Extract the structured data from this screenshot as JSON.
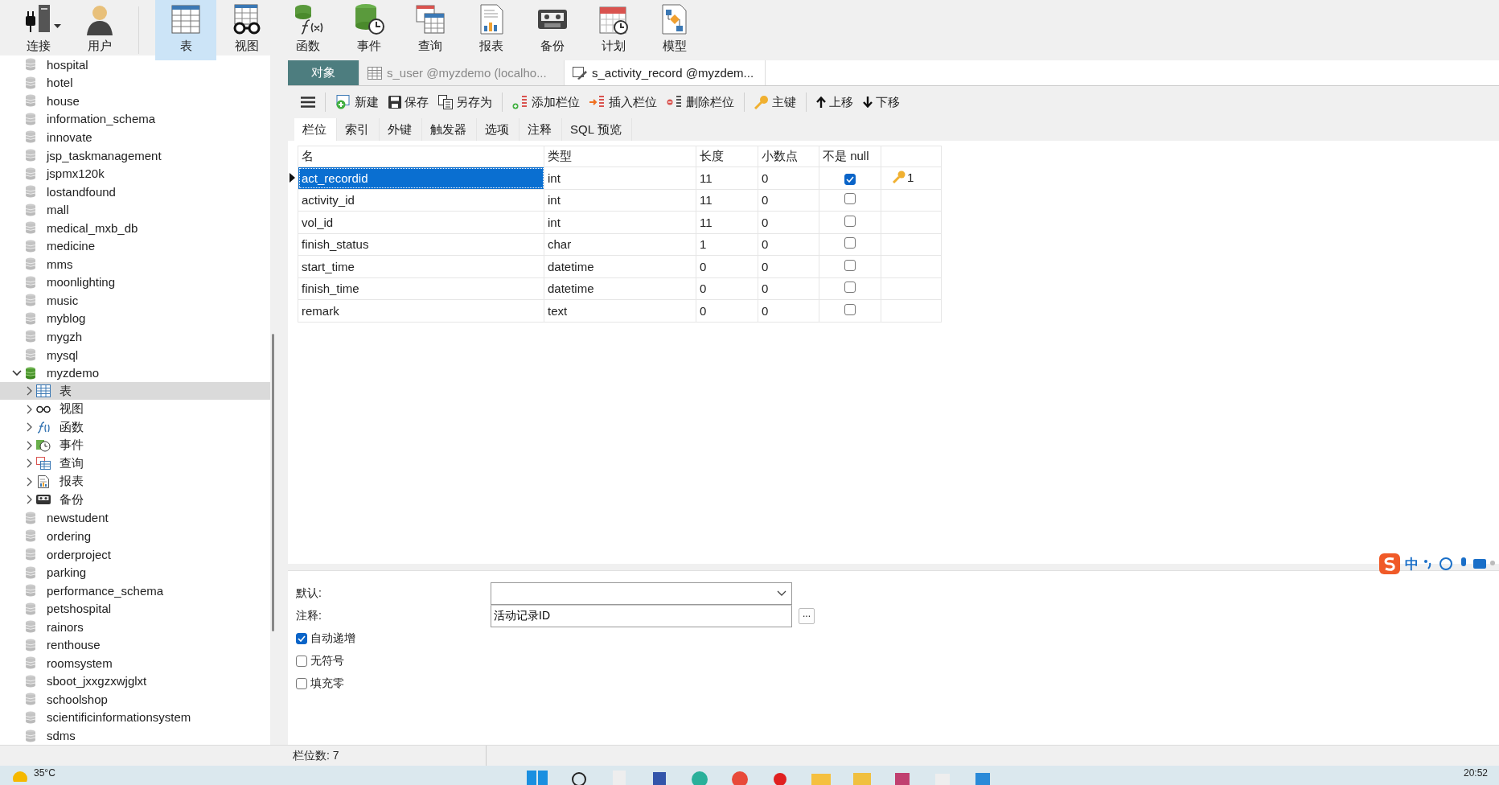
{
  "main_toolbar": [
    {
      "label": "连接",
      "kind": "connection",
      "selected": false,
      "has_menu": true
    },
    {
      "label": "用户",
      "kind": "user",
      "selected": false,
      "has_menu": false
    },
    {
      "label": "表",
      "kind": "table",
      "selected": true,
      "has_menu": false
    },
    {
      "label": "视图",
      "kind": "view",
      "selected": false,
      "has_menu": false
    },
    {
      "label": "函数",
      "kind": "function",
      "selected": false,
      "has_menu": false
    },
    {
      "label": "事件",
      "kind": "event",
      "selected": false,
      "has_menu": false
    },
    {
      "label": "查询",
      "kind": "query",
      "selected": false,
      "has_menu": false
    },
    {
      "label": "报表",
      "kind": "report",
      "selected": false,
      "has_menu": false
    },
    {
      "label": "备份",
      "kind": "backup",
      "selected": false,
      "has_menu": false
    },
    {
      "label": "计划",
      "kind": "schedule",
      "selected": false,
      "has_menu": false
    },
    {
      "label": "模型",
      "kind": "model",
      "selected": false,
      "has_menu": false
    }
  ],
  "sidebar": {
    "items": [
      {
        "label": "hospital",
        "kind": "database",
        "expanded": false,
        "selected": false
      },
      {
        "label": "hotel",
        "kind": "database",
        "expanded": false,
        "selected": false
      },
      {
        "label": "house",
        "kind": "database",
        "expanded": false,
        "selected": false
      },
      {
        "label": "information_schema",
        "kind": "database",
        "expanded": false,
        "selected": false
      },
      {
        "label": "innovate",
        "kind": "database",
        "expanded": false,
        "selected": false
      },
      {
        "label": "jsp_taskmanagement",
        "kind": "database",
        "expanded": false,
        "selected": false
      },
      {
        "label": "jspmx120k",
        "kind": "database",
        "expanded": false,
        "selected": false
      },
      {
        "label": "lostandfound",
        "kind": "database",
        "expanded": false,
        "selected": false
      },
      {
        "label": "mall",
        "kind": "database",
        "expanded": false,
        "selected": false
      },
      {
        "label": "medical_mxb_db",
        "kind": "database",
        "expanded": false,
        "selected": false
      },
      {
        "label": "medicine",
        "kind": "database",
        "expanded": false,
        "selected": false
      },
      {
        "label": "mms",
        "kind": "database",
        "expanded": false,
        "selected": false
      },
      {
        "label": "moonlighting",
        "kind": "database",
        "expanded": false,
        "selected": false
      },
      {
        "label": "music",
        "kind": "database",
        "expanded": false,
        "selected": false
      },
      {
        "label": "myblog",
        "kind": "database",
        "expanded": false,
        "selected": false
      },
      {
        "label": "mygzh",
        "kind": "database",
        "expanded": false,
        "selected": false
      },
      {
        "label": "mysql",
        "kind": "database",
        "expanded": false,
        "selected": false
      },
      {
        "label": "myzdemo",
        "kind": "database",
        "expanded": true,
        "selected": false,
        "children": [
          {
            "label": "表",
            "kind": "table",
            "expanded": false,
            "selected": true
          },
          {
            "label": "视图",
            "kind": "view",
            "expanded": false,
            "selected": false
          },
          {
            "label": "函数",
            "kind": "function",
            "expanded": false,
            "selected": false
          },
          {
            "label": "事件",
            "kind": "event",
            "expanded": false,
            "selected": false
          },
          {
            "label": "查询",
            "kind": "query",
            "expanded": false,
            "selected": false
          },
          {
            "label": "报表",
            "kind": "report",
            "expanded": false,
            "selected": false
          },
          {
            "label": "备份",
            "kind": "backup",
            "expanded": false,
            "selected": false
          }
        ]
      },
      {
        "label": "newstudent",
        "kind": "database",
        "expanded": false,
        "selected": false
      },
      {
        "label": "ordering",
        "kind": "database",
        "expanded": false,
        "selected": false
      },
      {
        "label": "orderproject",
        "kind": "database",
        "expanded": false,
        "selected": false
      },
      {
        "label": "parking",
        "kind": "database",
        "expanded": false,
        "selected": false
      },
      {
        "label": "performance_schema",
        "kind": "database",
        "expanded": false,
        "selected": false
      },
      {
        "label": "petshospital",
        "kind": "database",
        "expanded": false,
        "selected": false
      },
      {
        "label": "rainors",
        "kind": "database",
        "expanded": false,
        "selected": false
      },
      {
        "label": "renthouse",
        "kind": "database",
        "expanded": false,
        "selected": false
      },
      {
        "label": "roomsystem",
        "kind": "database",
        "expanded": false,
        "selected": false
      },
      {
        "label": "sboot_jxxgzxwjglxt",
        "kind": "database",
        "expanded": false,
        "selected": false
      },
      {
        "label": "schoolshop",
        "kind": "database",
        "expanded": false,
        "selected": false
      },
      {
        "label": "scientificinformationsystem",
        "kind": "database",
        "expanded": false,
        "selected": false
      },
      {
        "label": "sdms",
        "kind": "database",
        "expanded": false,
        "selected": false
      }
    ]
  },
  "tabs": [
    {
      "label": "对象",
      "kind": "objects",
      "selected": false
    },
    {
      "label": "s_user @myzdemo (localho...",
      "kind": "table",
      "selected": false
    },
    {
      "label": "s_activity_record @myzdem...",
      "kind": "design",
      "selected": true
    }
  ],
  "editor_toolbar": [
    {
      "kind": "menu"
    },
    {
      "label": "新建",
      "kind": "new"
    },
    {
      "label": "保存",
      "kind": "save"
    },
    {
      "label": "另存为",
      "kind": "save_as"
    },
    {
      "label": "添加栏位",
      "kind": "add_field"
    },
    {
      "label": "插入栏位",
      "kind": "insert_field"
    },
    {
      "label": "删除栏位",
      "kind": "delete_field"
    },
    {
      "label": "主键",
      "kind": "primary_key"
    },
    {
      "label": "上移",
      "kind": "move_up"
    },
    {
      "label": "下移",
      "kind": "move_down"
    }
  ],
  "subtabs": [
    {
      "label": "栏位",
      "selected": true
    },
    {
      "label": "索引",
      "selected": false
    },
    {
      "label": "外键",
      "selected": false
    },
    {
      "label": "触发器",
      "selected": false
    },
    {
      "label": "选项",
      "selected": false
    },
    {
      "label": "注释",
      "selected": false
    },
    {
      "label": "SQL 预览",
      "selected": false
    }
  ],
  "table": {
    "columns": [
      "名",
      "类型",
      "长度",
      "小数点",
      "不是 null"
    ],
    "rows": [
      {
        "name": "act_recordid",
        "type": "int",
        "length": "11",
        "decimals": "0",
        "not_null": true,
        "key": "1",
        "selected": true
      },
      {
        "name": "activity_id",
        "type": "int",
        "length": "11",
        "decimals": "0",
        "not_null": false,
        "selected": false
      },
      {
        "name": "vol_id",
        "type": "int",
        "length": "11",
        "decimals": "0",
        "not_null": false,
        "selected": false
      },
      {
        "name": "finish_status",
        "type": "char",
        "length": "1",
        "decimals": "0",
        "not_null": false,
        "selected": false
      },
      {
        "name": "start_time",
        "type": "datetime",
        "length": "0",
        "decimals": "0",
        "not_null": false,
        "selected": false
      },
      {
        "name": "finish_time",
        "type": "datetime",
        "length": "0",
        "decimals": "0",
        "not_null": false,
        "selected": false
      },
      {
        "name": "remark",
        "type": "text",
        "length": "0",
        "decimals": "0",
        "not_null": false,
        "selected": false
      }
    ]
  },
  "field_properties": {
    "default": {
      "label": "默认:"
    },
    "comment": {
      "label": "注释:",
      "value": "活动记录ID",
      "button": "..."
    },
    "options": [
      {
        "label": "自动递增",
        "checked": true
      },
      {
        "label": "无符号",
        "checked": false
      },
      {
        "label": "填充零",
        "checked": false
      }
    ]
  },
  "ime_bar": {
    "mode": "中"
  },
  "status_bar": {
    "text": "栏位数: 7"
  },
  "taskbar": {
    "weather": "35°C",
    "time": "20:52"
  }
}
